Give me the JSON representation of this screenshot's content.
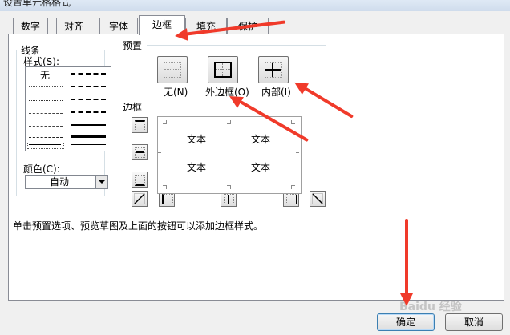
{
  "window": {
    "title": "设置单元格格式"
  },
  "tabs": [
    {
      "label": "数字",
      "active": false
    },
    {
      "label": "对齐",
      "active": false
    },
    {
      "label": "字体",
      "active": false
    },
    {
      "label": "边框",
      "active": true
    },
    {
      "label": "填充",
      "active": false
    },
    {
      "label": "保护",
      "active": false
    }
  ],
  "line": {
    "group_label": "线条",
    "style_label": "样式(S):",
    "none_label": "无",
    "color_label": "颜色(C):",
    "color_value": "自动"
  },
  "presets": {
    "group_label": "预置",
    "none_label": "无(N)",
    "outline_label": "外边框(O)",
    "inside_label": "内部(I)"
  },
  "border": {
    "group_label": "边框",
    "preview_texts": [
      "文本",
      "文本",
      "文本",
      "文本"
    ]
  },
  "hint_text": "单击预置选项、预览草图及上面的按钮可以添加边框样式。",
  "buttons": {
    "ok": "确定",
    "cancel": "取消"
  },
  "watermark": "Baidu 经验",
  "colors": {
    "annotation_arrow": "#f03a2a",
    "dialog_bg": "#f0f0f0",
    "panel_bg": "#ffffff"
  }
}
